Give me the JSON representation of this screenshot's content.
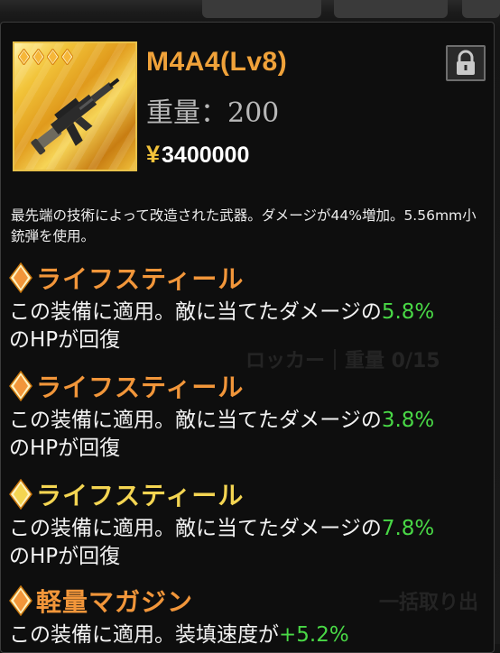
{
  "item": {
    "title": "M4A4(Lv8)",
    "weight_text": "重量：200",
    "price_symbol": "¥",
    "price_value": "3400000",
    "rarity_stars": 4,
    "description": "最先端の技術によって改造された武器。ダメージが44%増加。5.56mm小銃弾を使用。"
  },
  "skills": [
    {
      "name": "ライフスティール",
      "desc_pre": "この装備に適用。敵に当てたダメージの",
      "pct": "5.8%",
      "desc_post": "のHPが回復",
      "color": "#f2963a"
    },
    {
      "name": "ライフスティール",
      "desc_pre": "この装備に適用。敵に当てたダメージの",
      "pct": "3.8%",
      "desc_post": "のHPが回復",
      "color": "#f2963a"
    },
    {
      "name": "ライフスティール",
      "desc_pre": "この装備に適用。敵に当てたダメージの",
      "pct": "7.8%",
      "desc_post": "のHPが回復",
      "color": "#f4d552"
    },
    {
      "name": "軽量マガジン",
      "desc_pre": "この装備に適用。装填速度が",
      "pct": "+5.2%",
      "desc_post": "",
      "color": "#f2963a"
    }
  ],
  "icons": {
    "lock": "lock-icon",
    "rarity": "diamond-icon",
    "weapon": "rifle-icon"
  },
  "background_text": {
    "locker": "ロッカー｜重量 0/15",
    "bulk": "一括取り出"
  }
}
